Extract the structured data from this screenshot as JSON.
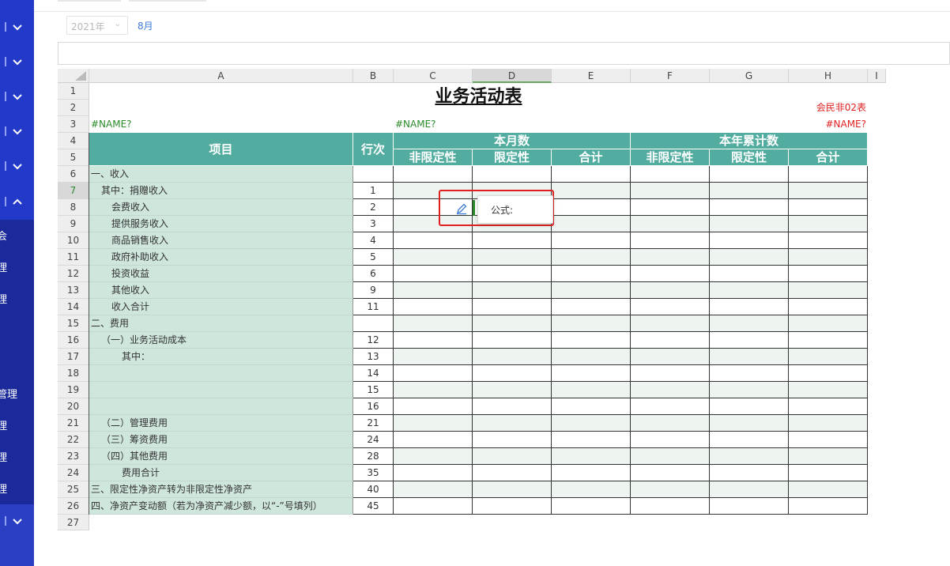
{
  "sidebar": {
    "labels": [
      "会",
      "理",
      "理",
      "管理",
      "理",
      "理",
      "理"
    ]
  },
  "toolbar": {
    "year": "2021年",
    "month": "8月"
  },
  "sheet": {
    "columns": [
      "A",
      "B",
      "C",
      "D",
      "E",
      "F",
      "G",
      "H",
      "I"
    ],
    "selected_column": "D",
    "selected_row": "7",
    "rows": [
      "1",
      "2",
      "3",
      "4",
      "5",
      "6",
      "7",
      "8",
      "9",
      "10",
      "11",
      "12",
      "13",
      "14",
      "15",
      "16",
      "17",
      "18",
      "19",
      "20",
      "21",
      "22",
      "23",
      "24",
      "25",
      "26",
      "27"
    ],
    "title": "业务活动表",
    "form_code": "会民非02表",
    "name_error": "#NAME?",
    "header": {
      "item": "项目",
      "line_no": "行次",
      "this_month": "本月数",
      "ytd": "本年累计数",
      "unrestricted": "非限定性",
      "restricted": "限定性",
      "total": "合计"
    },
    "lines": [
      {
        "label": "一、收入",
        "no": "",
        "indent": 0
      },
      {
        "label": "其中：捐赠收入",
        "no": "1",
        "indent": 1
      },
      {
        "label": "会费收入",
        "no": "2",
        "indent": 2
      },
      {
        "label": "提供服务收入",
        "no": "3",
        "indent": 2
      },
      {
        "label": "商品销售收入",
        "no": "4",
        "indent": 2
      },
      {
        "label": "政府补助收入",
        "no": "5",
        "indent": 2
      },
      {
        "label": "投资收益",
        "no": "6",
        "indent": 2
      },
      {
        "label": "其他收入",
        "no": "9",
        "indent": 2
      },
      {
        "label": "收入合计",
        "no": "11",
        "indent": 2
      },
      {
        "label": "二、费用",
        "no": "",
        "indent": 0
      },
      {
        "label": "（一）业务活动成本",
        "no": "12",
        "indent": 1
      },
      {
        "label": "其中：",
        "no": "13",
        "indent": 3
      },
      {
        "label": "",
        "no": "14",
        "indent": 0
      },
      {
        "label": "",
        "no": "15",
        "indent": 0
      },
      {
        "label": "",
        "no": "16",
        "indent": 0
      },
      {
        "label": "（二）管理费用",
        "no": "21",
        "indent": 1
      },
      {
        "label": "（三）筹资费用",
        "no": "24",
        "indent": 1
      },
      {
        "label": "（四）其他费用",
        "no": "28",
        "indent": 1
      },
      {
        "label": "费用合计",
        "no": "35",
        "indent": 3
      },
      {
        "label": "三、限定性净资产转为非限定性净资产",
        "no": "40",
        "indent": 0
      },
      {
        "label": "四、净资产变动额（若为净资产减少额，以“-”号填列）",
        "no": "45",
        "indent": 0
      }
    ]
  },
  "popup": {
    "formula_label": "公式:"
  }
}
